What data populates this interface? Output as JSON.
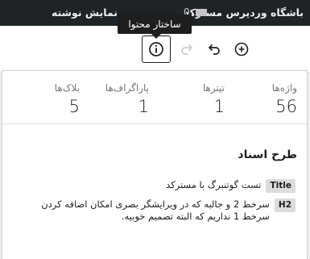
{
  "adminbar": {
    "site_name": "باشگاه وردپرس مسترکد",
    "comments_count": "0",
    "view_post": "نمایش نوشته"
  },
  "toolbar": {
    "tooltip": "ساختار محتوا",
    "info_icon": "info-icon",
    "redo_icon": "redo-icon",
    "undo_icon": "undo-icon",
    "add_icon": "plus-circle-icon"
  },
  "stats": {
    "words_label": "واژه‌ها",
    "words_value": "56",
    "headings_label": "تیترها",
    "headings_value": "1",
    "paragraphs_label": "پاراگراف‌ها",
    "paragraphs_value": "1",
    "blocks_label": "بلاک‌ها",
    "blocks_value": "5"
  },
  "outline": {
    "title": "طرح اسناد",
    "items": [
      {
        "level": "Title",
        "text": "تست گوتنبرگ با مسترکد"
      },
      {
        "level": "H2",
        "text": "سرخط 2 و جالبه که در ویرایشگر بصری امکان اضافه کردن سرخط 1 نداریم که البته تصمیم خوبیه."
      }
    ]
  },
  "colors": {
    "adminbar_bg": "#1d2327",
    "tooltip_bg": "#1e1e1e",
    "badge_bg": "#dcdcde"
  }
}
